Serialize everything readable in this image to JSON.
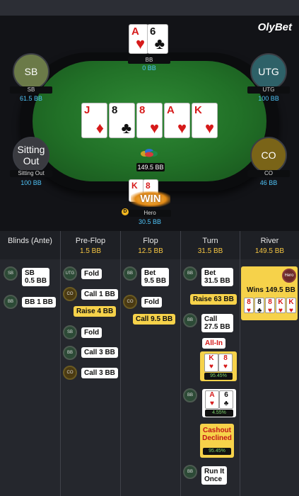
{
  "brand": "OlyBet",
  "colors": {
    "felt": "#217027",
    "stack": "#4fc3f7",
    "highlight": "#f6d24a"
  },
  "players": {
    "bb": {
      "name": "BB",
      "stack": "0 BB",
      "cards": [
        {
          "rank": "A",
          "suit": "♥"
        },
        {
          "rank": "6",
          "suit": "♣"
        }
      ]
    },
    "sb": {
      "avatar": "SB",
      "name": "SB",
      "stack": "61.5 BB"
    },
    "utg": {
      "avatar": "UTG",
      "name": "UTG",
      "stack": "100 BB"
    },
    "sitting_out": {
      "avatar_l1": "Sitting",
      "avatar_l2": "Out",
      "name": "Sitting Out",
      "stack": "100 BB"
    },
    "co": {
      "avatar": "CO",
      "name": "CO",
      "stack": "46 BB"
    },
    "hero": {
      "name": "Hero",
      "stack": "30.5 BB",
      "win_label": "WIN",
      "dealer": "D",
      "cards": [
        {
          "rank": "K",
          "suit": "♥"
        },
        {
          "rank": "8",
          "suit": "♥"
        }
      ]
    }
  },
  "board": [
    {
      "rank": "J",
      "suit": "♦"
    },
    {
      "rank": "8",
      "suit": "♣"
    },
    {
      "rank": "8",
      "suit": "♥"
    },
    {
      "rank": "A",
      "suit": "♥"
    },
    {
      "rank": "K",
      "suit": "♥"
    }
  ],
  "pot": "149.5 BB",
  "history": {
    "columns": [
      {
        "title": "Blinds (Ante)",
        "pot": ""
      },
      {
        "title": "Pre-Flop",
        "pot": "1.5 BB"
      },
      {
        "title": "Flop",
        "pot": "12.5 BB"
      },
      {
        "title": "Turn",
        "pot": "31.5 BB"
      },
      {
        "title": "River",
        "pot": "149.5 BB"
      }
    ],
    "blinds": [
      {
        "pos": "SB",
        "l1": "SB",
        "l2": "0.5 BB"
      },
      {
        "pos": "BB",
        "l1": "BB 1 BB"
      }
    ],
    "preflop": [
      {
        "pos": "UTG",
        "text": "Fold"
      },
      {
        "pos": "CO",
        "text": "Call 1 BB"
      },
      {
        "text": "Raise 4 BB"
      },
      {
        "pos": "SB",
        "text": "Fold"
      },
      {
        "pos": "BB",
        "text": "Call 3 BB"
      },
      {
        "pos": "CO",
        "text": "Call 3 BB"
      }
    ],
    "flop": [
      {
        "pos": "BB",
        "l1": "Bet",
        "l2": "9.5 BB"
      },
      {
        "pos": "CO",
        "text": "Fold"
      },
      {
        "text": "Call 9.5 BB"
      }
    ],
    "turn": {
      "bet": {
        "pos": "BB",
        "l1": "Bet",
        "l2": "31.5 BB"
      },
      "raise": "Raise 63 BB",
      "call": {
        "pos": "BB",
        "l1": "Call",
        "l2": "27.5 BB"
      },
      "allin": "All-In",
      "hero_cards": [
        {
          "rank": "K",
          "suit": "♥"
        },
        {
          "rank": "8",
          "suit": "♥"
        }
      ],
      "hero_equity": "95.45%",
      "bb_cards": [
        {
          "rank": "A",
          "suit": "♥"
        },
        {
          "rank": "6",
          "suit": "♣"
        }
      ],
      "bb_equity": "4.55%",
      "cashout_l1": "Cashout",
      "cashout_l2": "Declined",
      "cashout_equity": "95.45%",
      "runit": {
        "pos": "BB",
        "l1": "Run It",
        "l2": "Once"
      }
    },
    "river": {
      "badge": "Hero",
      "wins": "Wins 149.5 BB",
      "cards": [
        {
          "rank": "8",
          "suit": "♥"
        },
        {
          "rank": "8",
          "suit": "♣"
        },
        {
          "rank": "8",
          "suit": "♥"
        },
        {
          "rank": "K",
          "suit": "♥"
        },
        {
          "rank": "K",
          "suit": "♥"
        }
      ]
    }
  }
}
